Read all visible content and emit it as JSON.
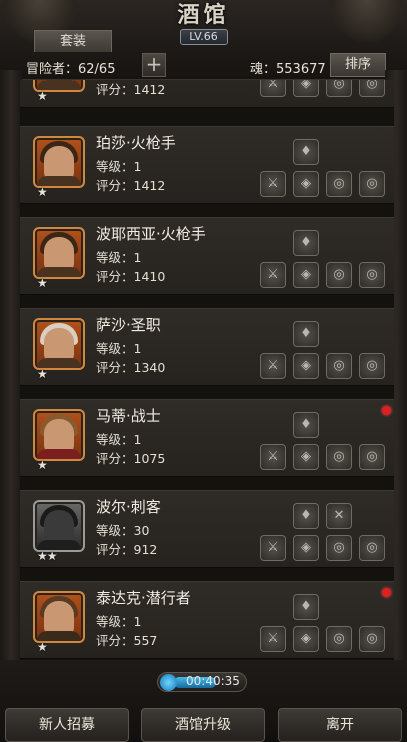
{
  "header": {
    "title": "酒馆",
    "level": "LV.66",
    "set_tab": "套装",
    "adventurer_count": "冒险者：62/65",
    "add_label": "+",
    "souls": "魂：553677",
    "sort_label": "排序"
  },
  "partial_card": {
    "score": "评分：1412"
  },
  "heroes": [
    {
      "name": "珀莎·火枪手",
      "level": "等级：1",
      "score": "评分：1412",
      "stars": "★",
      "new": false
    },
    {
      "name": "波耶西亚·火枪手",
      "level": "等级：1",
      "score": "评分：1410",
      "stars": "★",
      "new": false
    },
    {
      "name": "萨沙·圣职",
      "level": "等级：1",
      "score": "评分：1340",
      "stars": "★",
      "new": false
    },
    {
      "name": "马蒂·战士",
      "level": "等级：1",
      "score": "评分：1075",
      "stars": "★",
      "new": true
    },
    {
      "name": "波尔·刺客",
      "level": "等级：30",
      "score": "评分：912",
      "stars": "★★",
      "new": false
    },
    {
      "name": "泰达克·潜行者",
      "level": "等级：1",
      "score": "评分：557",
      "stars": "★",
      "new": true
    }
  ],
  "timer": {
    "label": "00:40:35",
    "progress": 0.6
  },
  "bottom": {
    "recruit": "新人招募",
    "upgrade": "酒馆升级",
    "leave": "离开"
  },
  "colors": {
    "new_dot": "#e02020",
    "portrait": "#b1521a",
    "timer": "#4ab8ea"
  },
  "icons": [
    "slot-potion-icon",
    "slot-weapon-icon",
    "slot-armor-icon",
    "slot-ring-icon",
    "slot-amulet-icon",
    "slot-ability-icon"
  ]
}
